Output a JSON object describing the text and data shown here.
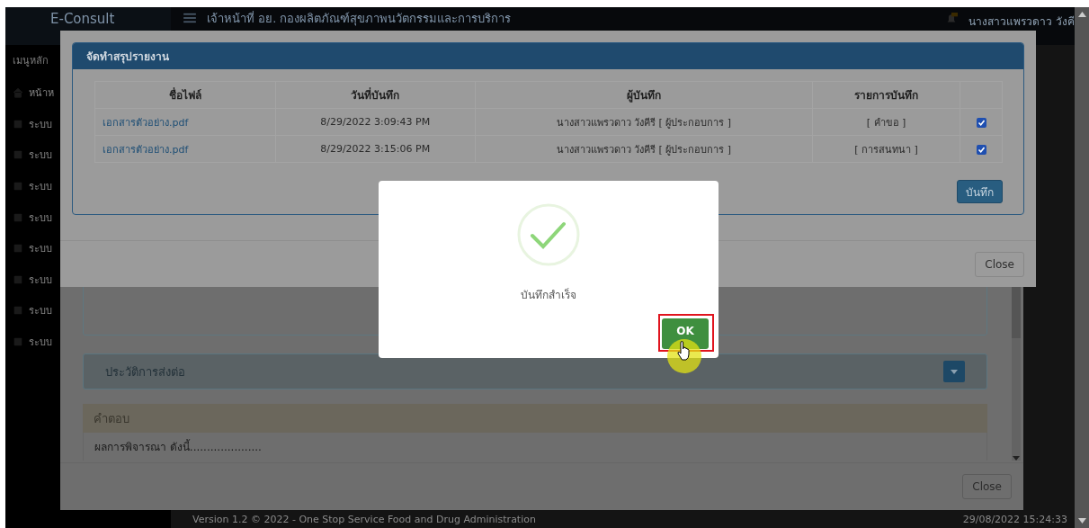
{
  "app": {
    "brand": "E-Consult",
    "header_title": "เจ้าหน้าที่ อย. กองผลิตภัณฑ์สุขภาพนวัตกรรมและการบริการ",
    "user_name": "นางสาวแพรวดาว วังคี",
    "sidebar": {
      "heading": "เมนูหลัก",
      "items": [
        {
          "label": "หน้าห"
        },
        {
          "label": "ระบบ"
        },
        {
          "label": "ระบบ"
        },
        {
          "label": "ระบบ"
        },
        {
          "label": "ระบบ"
        },
        {
          "label": "ระบบ"
        },
        {
          "label": "ระบบ"
        },
        {
          "label": "ระบบ"
        },
        {
          "label": "ระบบ"
        }
      ]
    },
    "footer": {
      "version": "Version 1.2 © 2022 - One Stop Service Food and Drug Administration",
      "timestamp": "29/08/2022 15:24:33"
    }
  },
  "detail_modal": {
    "history_title": "ประวัติการส่งต่อ",
    "answer_title": "คำตอบ",
    "answer_body": "ผลการพิจารณา ดังนี้.....................",
    "close_label": "Close"
  },
  "report_modal": {
    "title": "จัดทำสรุปรายงาน",
    "columns": [
      "ชื่อไฟล์",
      "วันที่บันทึก",
      "ผู้บันทึก",
      "รายการบันทึก"
    ],
    "rows": [
      {
        "file": "เอกสารตัวอย่าง.pdf",
        "date": "8/29/2022 3:09:43 PM",
        "recorder": "นางสาวแพรวดาว วังคีรี [ ผู้ประกอบการ ]",
        "item": "[ คำขอ ]",
        "checked": true
      },
      {
        "file": "เอกสารตัวอย่าง.pdf",
        "date": "8/29/2022 3:15:06 PM",
        "recorder": "นางสาวแพรวดาว วังคีรี [ ผู้ประกอบการ ]",
        "item": "[ การสนทนา ]",
        "checked": true
      }
    ],
    "save_label": "บันทึก",
    "close_label": "Close"
  },
  "success_dialog": {
    "message": "บันทึกสำเร็จ",
    "ok_label": "OK"
  }
}
